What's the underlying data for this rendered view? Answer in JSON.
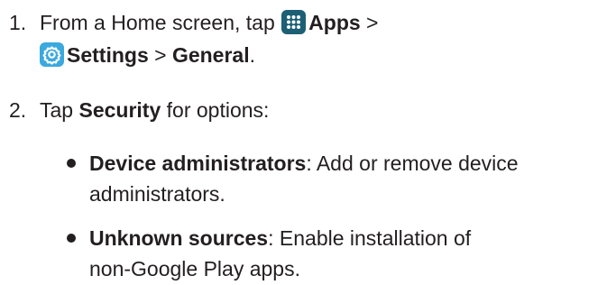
{
  "steps": [
    {
      "number": "1.",
      "line1": {
        "pre": "From a Home screen, tap ",
        "apps_label": "Apps",
        "sep": " >"
      },
      "line2": {
        "settings_label": "Settings",
        "sep": " > ",
        "general_label": "General",
        "end": "."
      }
    },
    {
      "number": "2.",
      "pre": "Tap ",
      "security_label": "Security",
      "post": " for options:"
    }
  ],
  "options": [
    {
      "term": "Device administrators",
      "desc_line1": ": Add or remove device",
      "desc_line2": "administrators."
    },
    {
      "term": "Unknown sources",
      "desc_line1": ": Enable installation of",
      "desc_line2": "non-Google Play apps."
    }
  ],
  "icons": {
    "apps": "apps-grid-icon",
    "settings": "settings-gear-icon",
    "apps_color": "#1d5f74",
    "settings_color": "#3aa9de"
  }
}
